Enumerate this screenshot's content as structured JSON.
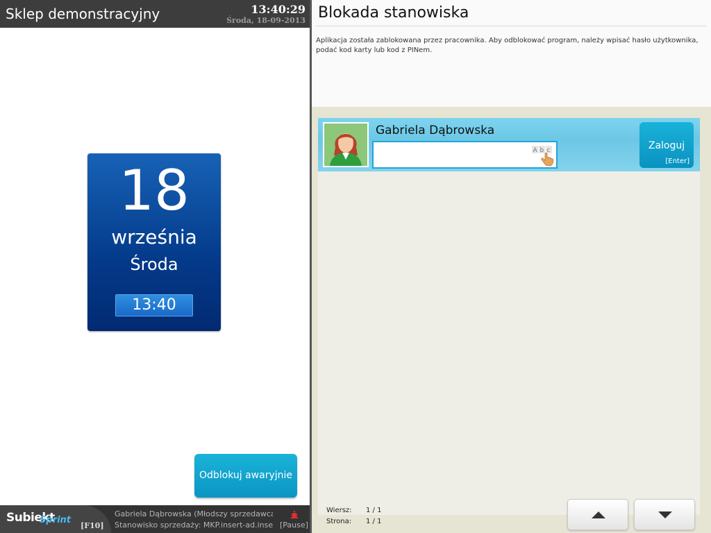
{
  "left": {
    "shop_title": "Sklep demonstracyjny",
    "clock": "13:40:29",
    "date_small": "Środa, 18-09-2013",
    "date_card": {
      "day": "18",
      "month": "września",
      "weekday": "Środa",
      "time": "13:40"
    },
    "emergency_unlock_label": "Odblokuj awaryjnie",
    "footer": {
      "logo_main": "Subiekt",
      "logo_sub": "Sprint",
      "f10": "[F10]",
      "user": "Gabriela Dąbrowska (Młodszy sprzedawca)",
      "station": "Stanowisko sprzedaży: MKP.insert-ad.insert....",
      "pause": "[Pause]"
    }
  },
  "right": {
    "title": "Blokada stanowiska",
    "description": "Aplikacja została zablokowana przez pracownika. Aby odblokować program, należy wpisać hasło użytkownika, podać kod karty lub kod z PINem.",
    "user": {
      "name": "Gabriela Dąbrowska",
      "password_value": "",
      "input_icon_text": "Abc"
    },
    "login_button": {
      "label": "Zaloguj",
      "shortcut": "[Enter]"
    },
    "pager": {
      "row_label": "Wiersz:",
      "row_value": "1 / 1",
      "page_label": "Strona:",
      "page_value": "1 / 1"
    }
  },
  "colors": {
    "header_bg": "#3d3d3d",
    "card_blue": "#043a8a",
    "accent_cyan": "#19b2d9",
    "row_highlight": "#7ed4ef",
    "list_bg": "#e6e4d2"
  },
  "icons": [
    "hand-touch-icon",
    "alarm-icon",
    "arrow-up-icon",
    "arrow-down-icon",
    "avatar-woman-icon"
  ]
}
